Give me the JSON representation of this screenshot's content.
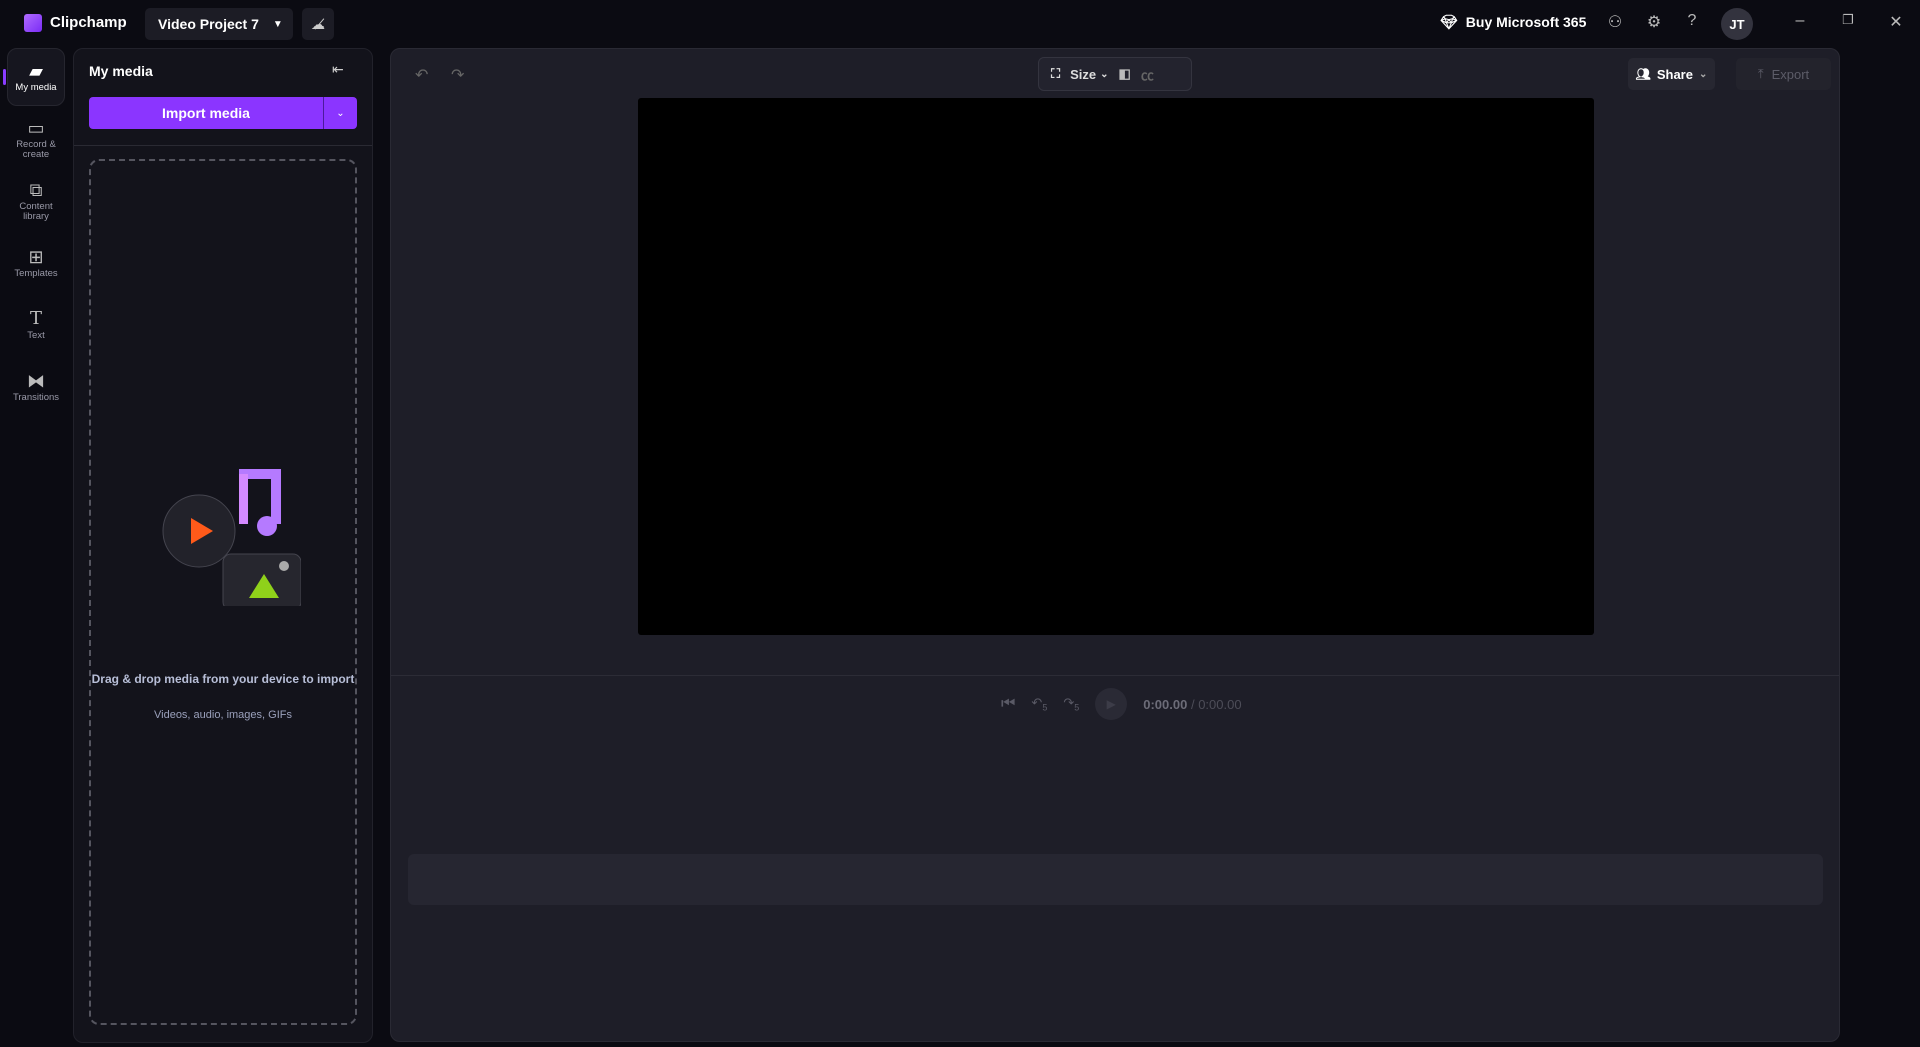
{
  "app": {
    "name": "Clipchamp",
    "project_title": "Video Project 7",
    "buy_label": "Buy Microsoft 365",
    "avatar_initials": "JT",
    "accent": "#8b35ff"
  },
  "nav": [
    {
      "label": "My media",
      "icon": "folder-icon",
      "active": true
    },
    {
      "label": "Record & create",
      "icon": "video-camera-icon"
    },
    {
      "label": "Content library",
      "icon": "content-library-icon"
    },
    {
      "label": "Templates",
      "icon": "templates-icon"
    },
    {
      "label": "Text",
      "icon": "text-icon"
    },
    {
      "label": "Transitions",
      "icon": "transitions-icon"
    }
  ],
  "media_panel": {
    "title": "My media",
    "import_label": "Import media",
    "drop_title": "Drag & drop media from your device to import",
    "drop_subtitle": "Videos, audio, images, GIFs"
  },
  "editor": {
    "size_label": "Size",
    "share_label": "Share",
    "export_label": "Export",
    "current_time": "0:00.00",
    "total_time": "/ 0:00.00",
    "skip_seconds": "5"
  }
}
